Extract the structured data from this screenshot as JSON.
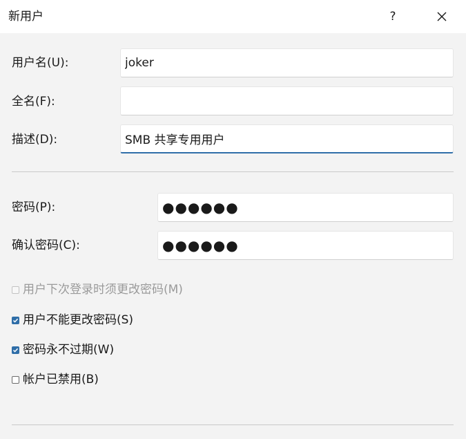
{
  "window": {
    "title": "新用户",
    "help_label": "?",
    "close_icon": "close-icon"
  },
  "fields": {
    "username": {
      "label": "用户名(U):",
      "value": "joker"
    },
    "fullname": {
      "label": "全名(F):",
      "value": ""
    },
    "description": {
      "label": "描述(D):",
      "value": "SMB 共享专用用户"
    },
    "password": {
      "label": "密码(P):",
      "value": "●●●●●●"
    },
    "confirm_password": {
      "label": "确认密码(C):",
      "value": "●●●●●●"
    }
  },
  "options": {
    "must_change": {
      "label": "用户下次登录时须更改密码(M)",
      "checked": false,
      "enabled": false
    },
    "cannot_change": {
      "label": "用户不能更改密码(S)",
      "checked": true,
      "enabled": true
    },
    "never_expires": {
      "label": "密码永不过期(W)",
      "checked": true,
      "enabled": true
    },
    "disabled": {
      "label": "帐户已禁用(B)",
      "checked": false,
      "enabled": true
    }
  },
  "colors": {
    "accent": "#2f6ea8",
    "background": "#f3f3f3",
    "titlebar": "#ffffff"
  }
}
